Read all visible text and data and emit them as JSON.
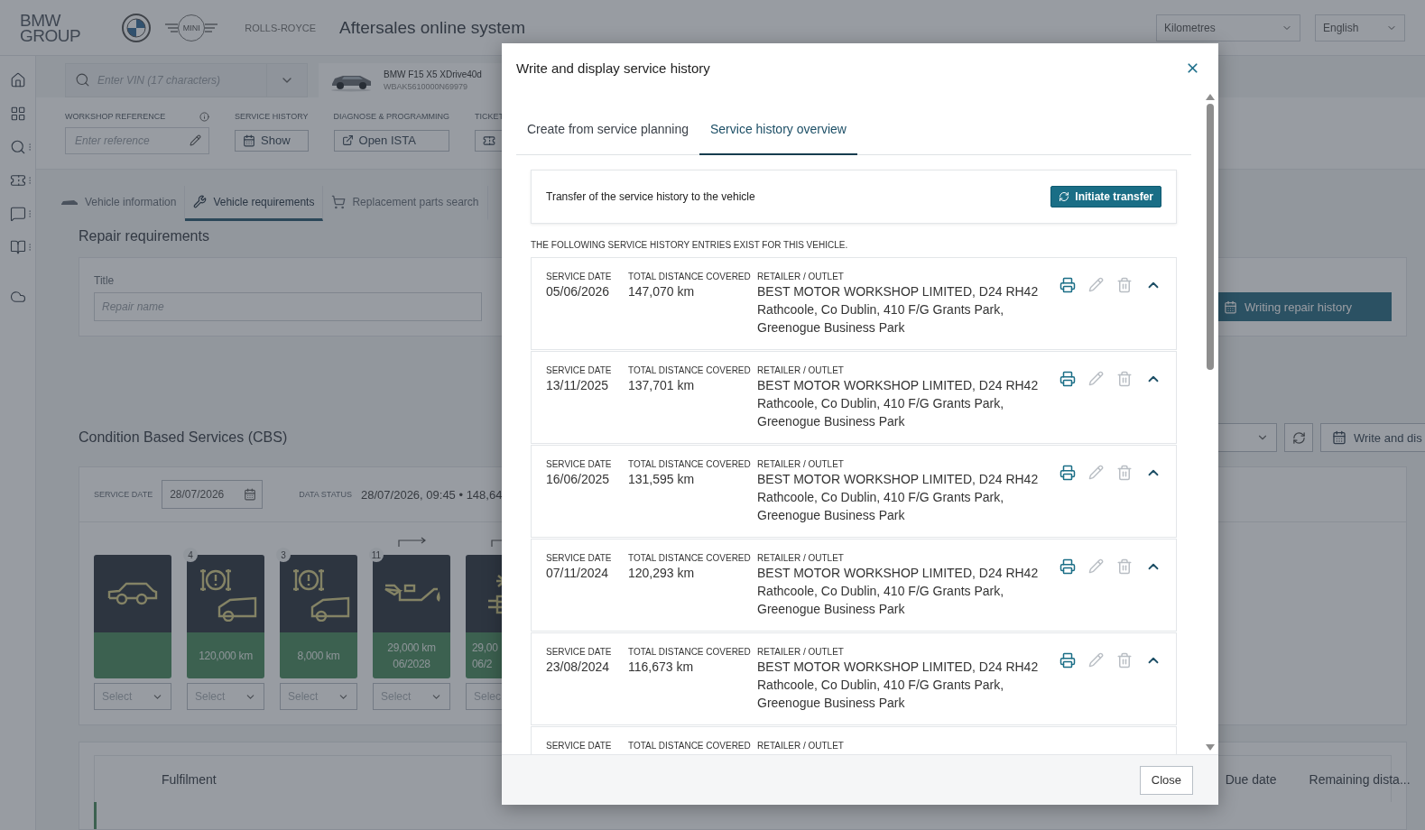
{
  "header": {
    "logo_lines": [
      "BMW",
      "GROUP"
    ],
    "brand_logos": [
      "MINI",
      "ROLLS-ROYCE"
    ],
    "title": "Aftersales online system",
    "unit_select": "Kilometres",
    "language_select": "English"
  },
  "sidebar": {
    "items": [
      {
        "kind": "home",
        "menu": false
      },
      {
        "kind": "grid",
        "menu": false
      },
      {
        "kind": "search",
        "menu": true
      },
      {
        "kind": "ticket",
        "menu": true
      },
      {
        "kind": "chat",
        "menu": true
      },
      {
        "kind": "book",
        "menu": true
      },
      {
        "kind": "cloud",
        "menu": false
      }
    ]
  },
  "vehicle_bar": {
    "vin_placeholder": "Enter VIN (17 characters)",
    "vehicle_name": "BMW F15 X5 XDrive40d",
    "vehicle_vin": "WBAK5610000N69979"
  },
  "tools": [
    {
      "kind": "field",
      "label": "WORKSHOP REFERENCE",
      "placeholder": "Enter reference"
    },
    {
      "kind": "button",
      "label": "SERVICE HISTORY",
      "button": "Show"
    },
    {
      "kind": "link",
      "label": "DIAGNOSE & PROGRAMMING",
      "button": "Open ISTA"
    },
    {
      "kind": "icon",
      "label": "TICKET"
    }
  ],
  "tabs": [
    {
      "label": "Vehicle information",
      "selected": false
    },
    {
      "label": "Vehicle requirements",
      "selected": true
    },
    {
      "label": "Replacement parts search",
      "selected": false
    }
  ],
  "repair": {
    "heading": "Repair requirements",
    "title_label": "Title",
    "title_placeholder": "Repair name",
    "history_button": "Writing repair history"
  },
  "cbs": {
    "heading": "Condition Based Services (CBS)",
    "write_button": "Write and dis",
    "service_date_label": "SERVICE DATE",
    "service_date": "28/07/2026",
    "data_status_label": "DATA STATUS",
    "data_status": "28/07/2026, 09:45 • 148,64",
    "tiles": [
      {
        "kind": "car",
        "select": "Select",
        "arrow": false
      },
      {
        "kind": "brake",
        "badge": "4",
        "values": [
          "120,000 km"
        ],
        "select": "Select",
        "arrow": false
      },
      {
        "kind": "brake",
        "badge": "3",
        "values": [
          "8,000 km"
        ],
        "select": "Select",
        "arrow": false
      },
      {
        "kind": "oil",
        "badge": "11",
        "values": [
          "29,000 km",
          "06/2028"
        ],
        "select": "Select",
        "arrow": true
      },
      {
        "kind": "filter",
        "values": [
          "29,00",
          "06/2"
        ],
        "select": "Selec",
        "arrow": true
      }
    ]
  },
  "fulfilment": {
    "columns": [
      "Fulfilment",
      "Due date",
      "Remaining dista..."
    ]
  },
  "modal": {
    "title": "Write and display service history",
    "tabs": [
      {
        "label": "Create from service planning",
        "selected": false
      },
      {
        "label": "Service history overview",
        "selected": true
      }
    ],
    "transfer_text": "Transfer of the service history to the vehicle",
    "transfer_button": "Initiate transfer",
    "list_heading": "THE FOLLOWING SERVICE HISTORY ENTRIES EXIST FOR THIS VEHICLE.",
    "entries": [
      {
        "columns": [
          {
            "label": "SERVICE DATE",
            "lines": [
              "05/06/2026"
            ]
          },
          {
            "label": "TOTAL DISTANCE COVERED",
            "lines": [
              "147,070 km"
            ]
          },
          {
            "label": "RETAILER / OUTLET",
            "lines": [
              "BEST MOTOR WORKSHOP LIMITED, D24 RH42",
              "Rathcoole, Co Dublin, 410 F/G Grants Park,",
              "Greenogue Business Park"
            ]
          }
        ],
        "actions": {
          "edit_disabled": true,
          "delete_disabled": true,
          "expanded": true
        }
      },
      {
        "columns": [
          {
            "label": "SERVICE DATE",
            "lines": [
              "13/11/2025"
            ]
          },
          {
            "label": "TOTAL DISTANCE COVERED",
            "lines": [
              "137,701 km"
            ]
          },
          {
            "label": "RETAILER / OUTLET",
            "lines": [
              "BEST MOTOR WORKSHOP LIMITED, D24 RH42",
              "Rathcoole, Co Dublin, 410 F/G Grants Park,",
              "Greenogue Business Park"
            ]
          }
        ],
        "actions": {
          "edit_disabled": true,
          "delete_disabled": true,
          "expanded": true
        }
      },
      {
        "columns": [
          {
            "label": "SERVICE DATE",
            "lines": [
              "16/06/2025"
            ]
          },
          {
            "label": "TOTAL DISTANCE COVERED",
            "lines": [
              "131,595 km"
            ]
          },
          {
            "label": "RETAILER / OUTLET",
            "lines": [
              "BEST MOTOR WORKSHOP LIMITED, D24 RH42",
              "Rathcoole, Co Dublin, 410 F/G Grants Park,",
              "Greenogue Business Park"
            ]
          }
        ],
        "actions": {
          "edit_disabled": true,
          "delete_disabled": true,
          "expanded": true
        }
      },
      {
        "columns": [
          {
            "label": "SERVICE DATE",
            "lines": [
              "07/11/2024"
            ]
          },
          {
            "label": "TOTAL DISTANCE COVERED",
            "lines": [
              "120,293 km"
            ]
          },
          {
            "label": "RETAILER / OUTLET",
            "lines": [
              "BEST MOTOR WORKSHOP LIMITED, D24 RH42",
              "Rathcoole, Co Dublin, 410 F/G Grants Park,",
              "Greenogue Business Park"
            ]
          }
        ],
        "actions": {
          "edit_disabled": true,
          "delete_disabled": true,
          "expanded": true
        }
      },
      {
        "columns": [
          {
            "label": "SERVICE DATE",
            "lines": [
              "23/08/2024"
            ]
          },
          {
            "label": "TOTAL DISTANCE COVERED",
            "lines": [
              "116,673 km"
            ]
          },
          {
            "label": "RETAILER / OUTLET",
            "lines": [
              "BEST MOTOR WORKSHOP LIMITED, D24 RH42",
              "Rathcoole, Co Dublin, 410 F/G Grants Park,",
              "Greenogue Business Park"
            ]
          }
        ],
        "actions": {
          "edit_disabled": true,
          "delete_disabled": true,
          "expanded": true
        }
      },
      {
        "columns": [
          {
            "label": "SERVICE DATE"
          },
          {
            "label": "TOTAL DISTANCE COVERED"
          },
          {
            "label": "RETAILER / OUTLET"
          }
        ]
      }
    ],
    "close_button": "Close"
  }
}
